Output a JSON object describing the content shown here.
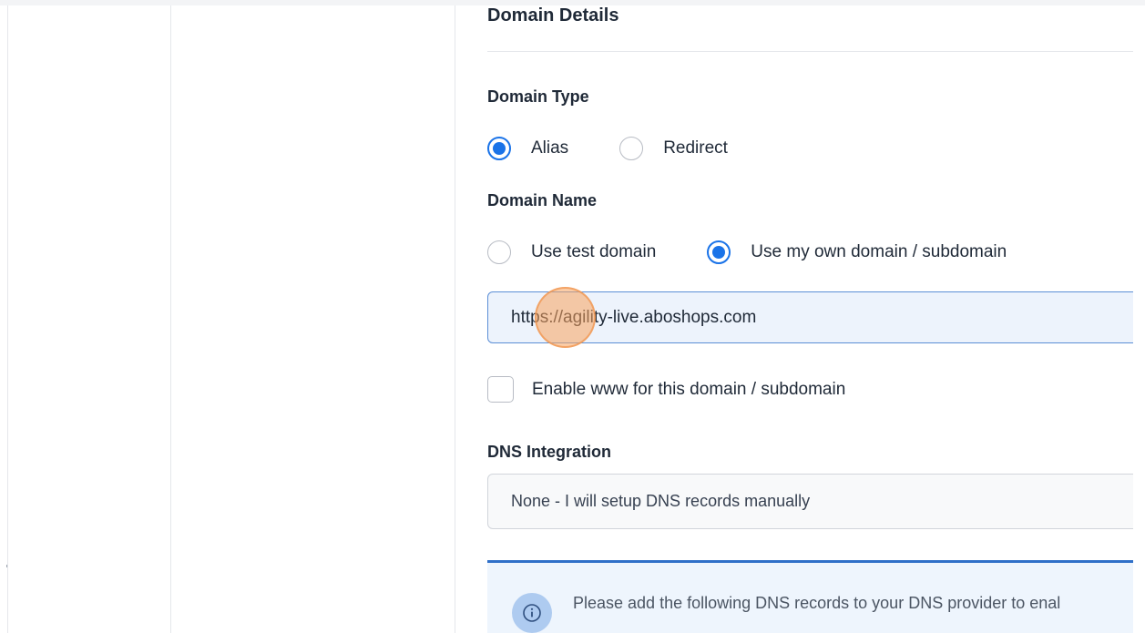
{
  "domain_details": {
    "title": "Domain Details"
  },
  "domain_type": {
    "label": "Domain Type",
    "options": [
      {
        "label": "Alias",
        "checked": true
      },
      {
        "label": "Redirect",
        "checked": false
      }
    ]
  },
  "domain_name": {
    "label": "Domain Name",
    "options": [
      {
        "label": "Use test domain",
        "checked": false
      },
      {
        "label": "Use my own domain / subdomain",
        "checked": true
      }
    ],
    "input_value": "https://agility-live.aboshops.com"
  },
  "www_option": {
    "label": "Enable www for this domain / subdomain",
    "checked": false
  },
  "dns_integration": {
    "label": "DNS Integration",
    "selected": "None - I will setup DNS records manually"
  },
  "info_notice": {
    "text": "Please add the following DNS records to your DNS provider to enal",
    "icon": "info-icon"
  },
  "colors": {
    "accent": "#1a73e8",
    "info_border": "#2f6fc8",
    "cursor_highlight": "#f7a35c"
  }
}
